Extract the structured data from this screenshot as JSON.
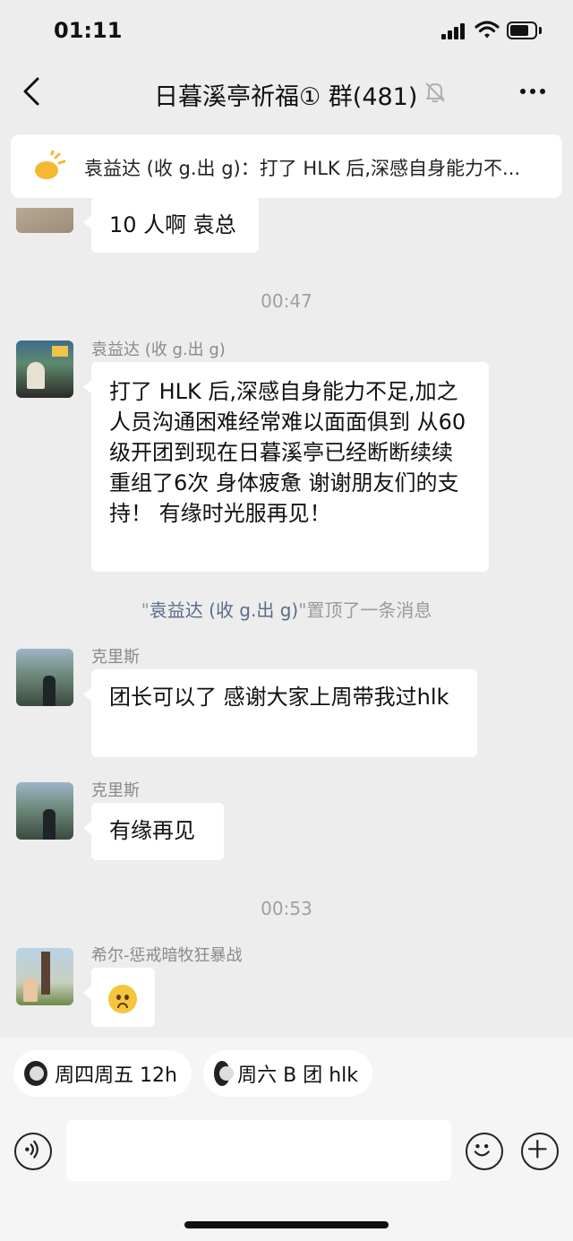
{
  "status_bar": {
    "time": "01:11"
  },
  "header": {
    "title": "日暮溪亭祈福① 群(481)"
  },
  "pinned": {
    "text": "袁益达 (收 g.出 g)：打了 HLK 后,深感自身能力不..."
  },
  "messages": {
    "m0": {
      "text": "10 人啊 袁总"
    },
    "ts1": "00:47",
    "m1": {
      "sender": "袁益达 (收 g.出 g)",
      "text": "打了 HLK 后,深感自身能力不足,加之人员沟通困难经常难以面面俱到 从60级开团到现在日暮溪亭已经断断续续重组了6次 身体疲惫 谢谢朋友们的支持！ 有缘时光服再见！"
    },
    "sys1": {
      "prefix": "\"",
      "who": "袁益达 (收 g.出 g)",
      "suffix": "\"置顶了一条消息"
    },
    "m2": {
      "sender": "克里斯",
      "text": "团长可以了 感谢大家上周带我过hlk"
    },
    "m3": {
      "sender": "克里斯",
      "text": "有缘再见"
    },
    "ts2": "00:53",
    "m4": {
      "sender": "希尔-惩戒暗牧狂暴战"
    }
  },
  "quick_replies": [
    {
      "label": "周四周五 12h"
    },
    {
      "label": "周六 B 团 hlk"
    }
  ],
  "colors": {
    "background": "#ededed",
    "bubble": "#ffffff",
    "sender": "#8a8a8a",
    "link": "#5b6b8c"
  }
}
